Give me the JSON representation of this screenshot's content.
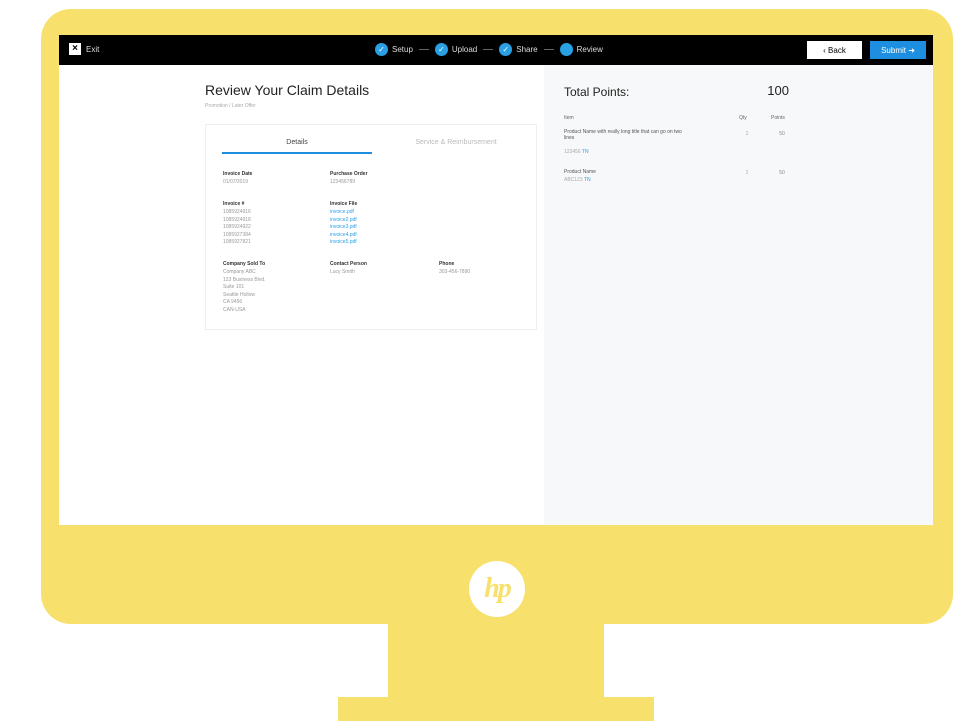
{
  "header": {
    "exit_label": "Exit",
    "steps": [
      {
        "label": "Setup",
        "done": true
      },
      {
        "label": "Upload",
        "done": true
      },
      {
        "label": "Share",
        "done": true
      },
      {
        "label": "Review",
        "done": false
      }
    ],
    "back_label": "‹  Back",
    "submit_label": "Submit ➜"
  },
  "claim": {
    "title": "Review Your Claim Details",
    "subtitle": "Promotion / Later Offer",
    "tabs": [
      "Details",
      "Service & Reimbursement"
    ],
    "invoice_date_label": "Invoice Date",
    "invoice_date": "01/07/2019",
    "purchase_order_label": "Purchase Order",
    "purchase_order": "123456789",
    "invoice_num_label": "Invoice #",
    "invoice_numbers": [
      "1085924916",
      "1085924918",
      "1085924922",
      "1085927384",
      "1085927821"
    ],
    "invoice_file_label": "Invoice File",
    "invoice_files": [
      "invoice.pdf",
      "invoice2.pdf",
      "invoice3.pdf",
      "invoice4.pdf",
      "invoice5.pdf"
    ],
    "company_label": "Company Sold To",
    "company_lines": [
      "Company ABC",
      "123 Business Blvd.",
      "Suite 101",
      "Seattle Hollow",
      "CA 9456",
      "CAN-USA"
    ],
    "contact_label": "Contact Person",
    "contact": "Lucy Smith",
    "phone_label": "Phone",
    "phone": "303-456-7890"
  },
  "points": {
    "label": "Total Points:",
    "total": "100",
    "col_item": "Item",
    "col_qty": "Qty",
    "col_points": "Points",
    "items": [
      {
        "name": "Product Name with really long title that can go on two lines",
        "sku": "123456",
        "sku_link": "TN",
        "qty": "1",
        "points": "50"
      },
      {
        "name": "Product Name",
        "sku": "ABC123",
        "sku_link": "TN",
        "qty": "1",
        "points": "50"
      }
    ]
  },
  "brand": {
    "logo_text": "hp",
    "accent": "#f7e16c",
    "blue": "#1e8fe0"
  }
}
